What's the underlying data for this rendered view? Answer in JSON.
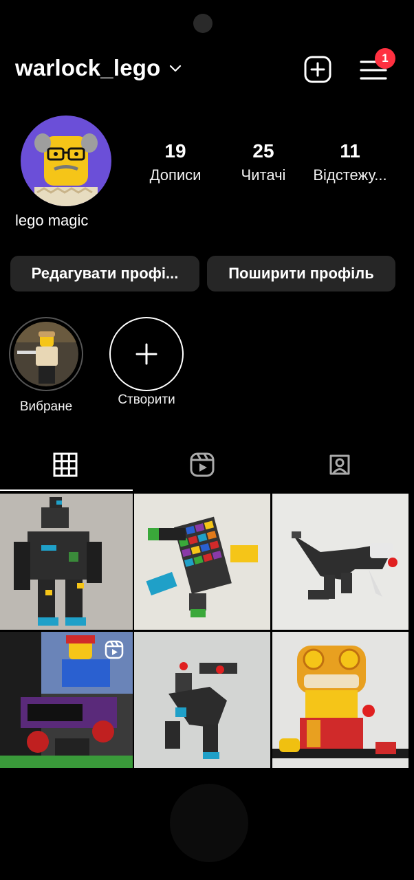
{
  "header": {
    "username": "warlock_lego",
    "notification_count": "1"
  },
  "profile": {
    "display_name": "lego magic",
    "stats": [
      {
        "value": "19",
        "label": "Дописи"
      },
      {
        "value": "25",
        "label": "Читачі"
      },
      {
        "value": "11",
        "label": "Відстежу..."
      }
    ]
  },
  "actions": {
    "edit_profile": "Редагувати профі...",
    "share_profile": "Поширити профіль"
  },
  "highlights": [
    {
      "label": "Вибране"
    },
    {
      "label": "Створити"
    }
  ],
  "tabs": [
    {
      "icon": "grid-icon",
      "selected": true
    },
    {
      "icon": "reels-icon",
      "selected": false
    },
    {
      "icon": "tagged-icon",
      "selected": false
    }
  ],
  "posts": [
    {
      "subject": "black mech robot",
      "bg": "#bdb9b3"
    },
    {
      "subject": "multicolor brick figure",
      "bg": "#e6e4dd"
    },
    {
      "subject": "black dinosaur",
      "bg": "#e9e9e6"
    },
    {
      "subject": "minifig DJ scene",
      "bg": "#3a3a3a",
      "is_reel": true
    },
    {
      "subject": "grey mech robot",
      "bg": "#d3d5d3"
    },
    {
      "subject": "lion dance brickheadz",
      "bg": "#e4e4e2"
    }
  ],
  "colors": {
    "background": "#000000",
    "button": "#262626",
    "badge": "#ff3040",
    "avatar_bg": "#6b4fd8",
    "avatar_face": "#f5c518"
  }
}
